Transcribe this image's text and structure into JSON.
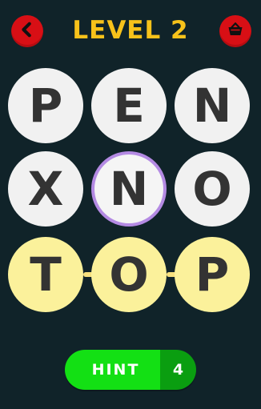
{
  "header": {
    "title": "LEVEL 2",
    "back_icon": "chevron-left-icon",
    "shop_icon": "basket-icon"
  },
  "board": {
    "rows": [
      {
        "tiles": [
          {
            "letter": "P",
            "state": "default"
          },
          {
            "letter": "E",
            "state": "default"
          },
          {
            "letter": "N",
            "state": "default"
          }
        ]
      },
      {
        "tiles": [
          {
            "letter": "X",
            "state": "default"
          },
          {
            "letter": "N",
            "state": "selected"
          },
          {
            "letter": "O",
            "state": "default"
          }
        ]
      },
      {
        "tiles": [
          {
            "letter": "T",
            "state": "found"
          },
          {
            "letter": "O",
            "state": "found"
          },
          {
            "letter": "P",
            "state": "found"
          }
        ]
      }
    ]
  },
  "hint": {
    "label": "HINT",
    "count": "4"
  },
  "colors": {
    "background": "#102329",
    "title": "#f7c21a",
    "icon_button": "#d80f15",
    "tile_default": "#f1f1f1",
    "tile_found": "#fbf19b",
    "selected_ring": "#b48ae3",
    "hint_primary": "#13e014",
    "hint_count_bg": "#0a9e10"
  }
}
